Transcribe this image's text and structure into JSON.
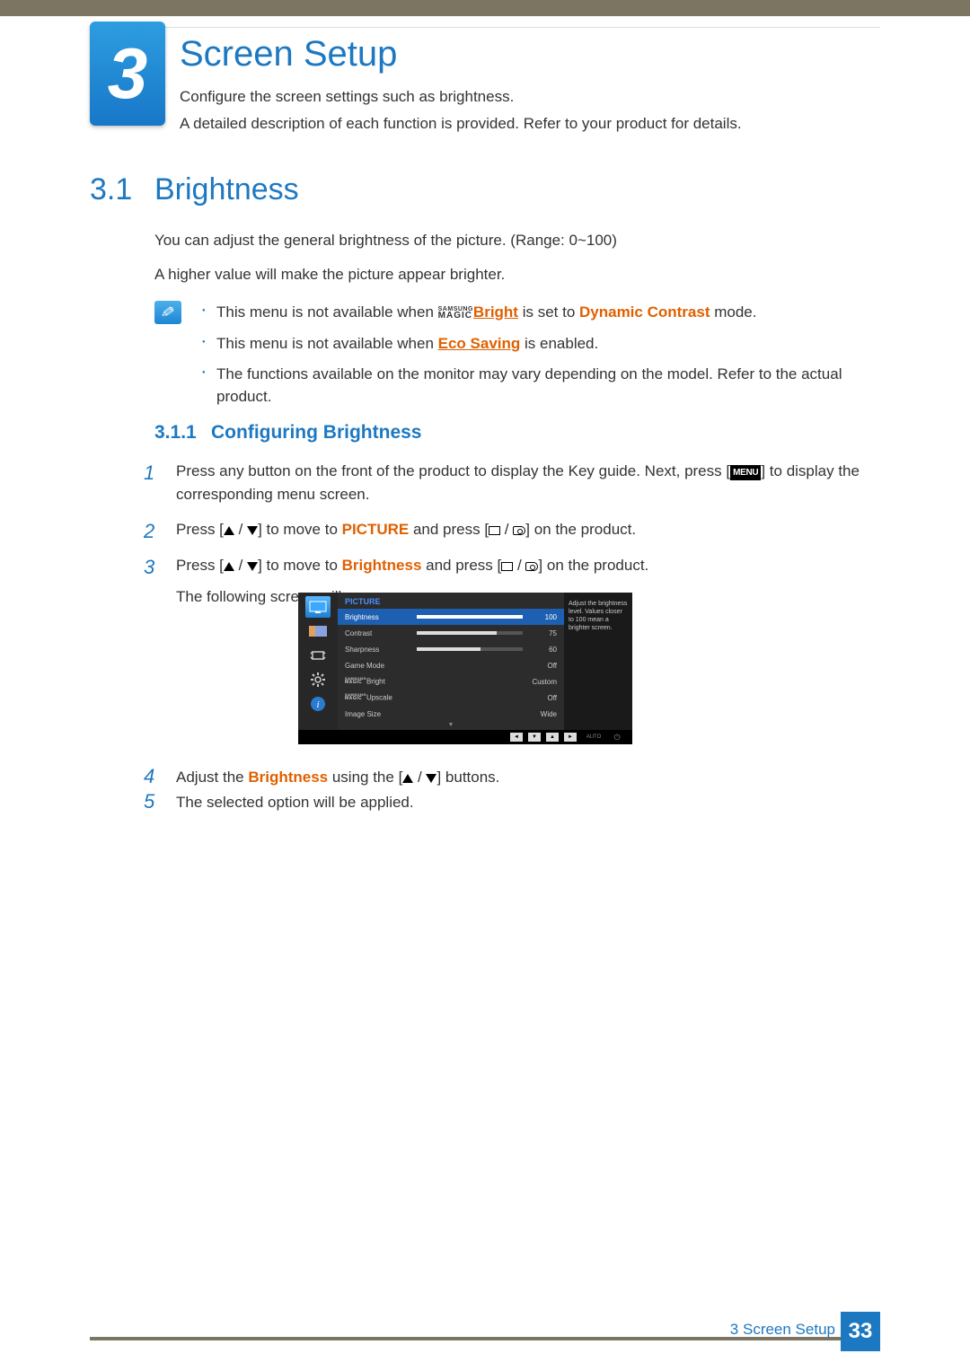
{
  "chapter": {
    "number": "3",
    "title": "Screen Setup"
  },
  "intro": {
    "line1": "Configure the screen settings such as brightness.",
    "line2": "A detailed description of each function is provided. Refer to your product for details."
  },
  "section": {
    "number": "3.1",
    "title": "Brightness"
  },
  "body": {
    "p1": "You can adjust the general brightness of the picture. (Range: 0~100)",
    "p2": "A higher value will make the picture appear brighter."
  },
  "notes": {
    "b1_pre": "This menu is not available when ",
    "b1_brand_top": "SAMSUNG",
    "b1_brand_bot": "MAGIC",
    "b1_link": "Bright",
    "b1_mid": " is set to ",
    "b1_mode": "Dynamic Contrast",
    "b1_post": " mode.",
    "b2_pre": "This menu is not available when ",
    "b2_link": "Eco Saving",
    "b2_post": " is enabled.",
    "b3": "The functions available on the monitor may vary depending on the model. Refer to the actual product."
  },
  "subsection": {
    "number": "3.1.1",
    "title": "Configuring Brightness"
  },
  "steps": {
    "s1_pre": "Press any button on the front of the product to display the Key guide. Next, press [",
    "s1_menu": "MENU",
    "s1_post": "] to display the corresponding menu screen.",
    "s2_pre": "Press [",
    "s2_mid": "] to move to ",
    "s2_target": "PICTURE",
    "s2_mid2": " and press [",
    "s2_post": "] on the product.",
    "s3_pre": "Press [",
    "s3_mid": "] to move to ",
    "s3_target": "Brightness",
    "s3_mid2": " and press [",
    "s3_post": "] on the product.",
    "s3_caption": "The following screen will appear.",
    "s4_pre": "Adjust the ",
    "s4_target": "Brightness",
    "s4_mid": " using the [",
    "s4_post": "] buttons.",
    "s5": "The selected option will be applied."
  },
  "osd": {
    "header": "PICTURE",
    "rows": [
      {
        "label": "Brightness",
        "type": "bar",
        "value": "100",
        "fill": 100,
        "selected": true
      },
      {
        "label": "Contrast",
        "type": "bar",
        "value": "75",
        "fill": 75,
        "selected": false
      },
      {
        "label": "Sharpness",
        "type": "bar",
        "value": "60",
        "fill": 60,
        "selected": false
      },
      {
        "label": "Game Mode",
        "type": "text",
        "value": "Off",
        "selected": false
      },
      {
        "label_brand": "Bright",
        "type": "text",
        "value": "Custom",
        "selected": false,
        "magic": true
      },
      {
        "label_brand": "Upscale",
        "type": "text",
        "value": "Off",
        "selected": false,
        "magic": true
      },
      {
        "label": "Image Size",
        "type": "text",
        "value": "Wide",
        "selected": false
      }
    ],
    "help": "Adjust the brightness level. Values closer to 100 mean a brighter screen.",
    "auto": "AUTO",
    "brand_top": "SAMSUNG",
    "brand_bot": "MAGIC"
  },
  "footer": {
    "label": "3 Screen Setup",
    "page": "33"
  }
}
